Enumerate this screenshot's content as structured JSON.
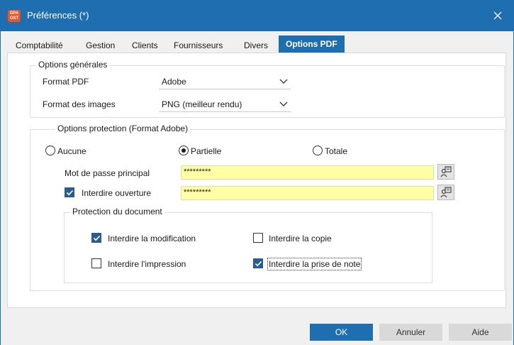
{
  "window": {
    "title": "Préférences (*)",
    "icon_label_top": "GPA",
    "icon_label_bottom": "OST"
  },
  "tabs": [
    {
      "label": "Comptabilité"
    },
    {
      "label": "Gestion"
    },
    {
      "label": "Clients"
    },
    {
      "label": "Fournisseurs"
    },
    {
      "label": "Divers"
    },
    {
      "label": "Options PDF"
    }
  ],
  "general": {
    "group_label": "Options générales",
    "format_pdf_label": "Format PDF",
    "format_pdf_value": "Adobe",
    "format_images_label": "Format des images",
    "format_images_value": "PNG (meilleur rendu)"
  },
  "protection": {
    "group_label": "Options protection (Format Adobe)",
    "radio_none": "Aucune",
    "radio_partial": "Partielle",
    "radio_total": "Totale",
    "selected": "Partielle",
    "main_password_label": "Mot de passe principal",
    "main_password_value": "*********",
    "forbid_open_label": "Interdire ouverture",
    "forbid_open_checked": true,
    "forbid_open_value": "*********"
  },
  "document_protection": {
    "group_label": "Protection du document",
    "forbid_modification": "Interdire la modification",
    "forbid_modification_checked": true,
    "forbid_copy": "Interdire la copie",
    "forbid_copy_checked": false,
    "forbid_print": "Interdire l'impression",
    "forbid_print_checked": false,
    "forbid_notes": "Interdire la prise de note",
    "forbid_notes_checked": true
  },
  "buttons": {
    "ok": "OK",
    "cancel": "Annuler",
    "help": "Aide"
  },
  "colors": {
    "accent": "#1f6fb0",
    "password_bg": "#ffffa6",
    "checkbox_checked": "#2a5c8f"
  }
}
